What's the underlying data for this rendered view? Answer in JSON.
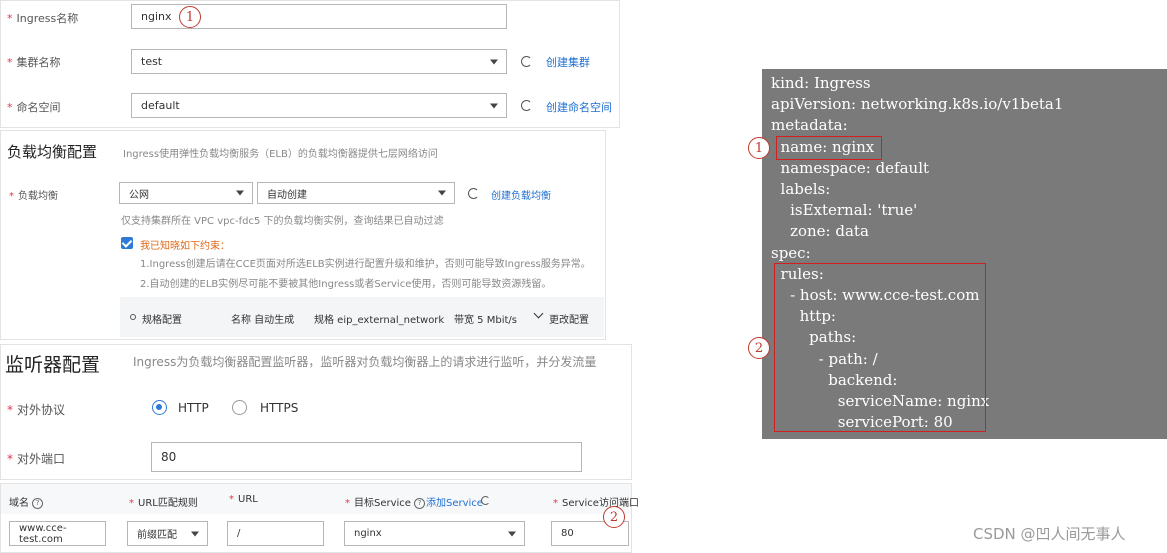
{
  "basic": {
    "ingress_name_label": "Ingress名称",
    "ingress_name_value": "nginx",
    "cluster_label": "集群名称",
    "cluster_value": "test",
    "create_cluster_link": "创建集群",
    "namespace_label": "命名空间",
    "namespace_value": "default",
    "create_namespace_link": "创建命名空间"
  },
  "lb": {
    "title": "负载均衡配置",
    "desc": "Ingress使用弹性负载均衡服务（ELB）的负载均衡器提供七层网络访问",
    "label": "负载均衡",
    "type_value": "公网",
    "mode_value": "自动创建",
    "create_link": "创建负载均衡",
    "vpc_hint": "仅支持集群所在 VPC vpc-fdc5 下的负载均衡实例，查询结果已自动过滤",
    "agree_label": "我已知晓如下约束：",
    "constraint_1": "1.Ingress创建后请在CCE页面对所选ELB实例进行配置升级和维护，否则可能导致Ingress服务异常。",
    "constraint_2": "2.自动创建的ELB实例尽可能不要被其他Ingress或者Service使用，否则可能导致资源残留。",
    "spec_label": "规格配置",
    "spec_name": "名称 自动生成",
    "spec_network": "规格 eip_external_network",
    "spec_bandwidth": "带宽 5 Mbit/s",
    "spec_change": "更改配置"
  },
  "listener": {
    "title": "监听器配置",
    "desc": "Ingress为负载均衡器配置监听器，监听器对负载均衡器上的请求进行监听，并分发流量",
    "protocol_label": "对外协议",
    "http_label": "HTTP",
    "https_label": "HTTPS",
    "protocol_selected": "HTTP",
    "port_label": "对外端口",
    "port_value": "80"
  },
  "forwarding": {
    "headers": {
      "domain": "域名",
      "url_rule": "URL匹配规则",
      "url": "URL",
      "target_service": "目标Service",
      "add_service": "添加Service",
      "service_port": "Service访问端口"
    },
    "row": {
      "domain": "www.cce-test.com",
      "url_rule": "前缀匹配",
      "url": "/",
      "target_service": "nginx",
      "service_port": "80"
    }
  },
  "yaml": {
    "lines": [
      "kind: Ingress",
      "apiVersion: networking.k8s.io/v1beta1",
      "metadata:",
      "  name: nginx",
      "  namespace: default",
      "  labels:",
      "    isExternal: 'true'",
      "    zone: data",
      "spec:",
      "  rules:",
      "    - host: www.cce-test.com",
      "      http:",
      "        paths:",
      "          - path: /",
      "            backend:",
      "              serviceName: nginx",
      "              servicePort: 80"
    ]
  },
  "markers": {
    "one": "1",
    "two": "2"
  },
  "watermark": "CSDN @凹人间无事人"
}
